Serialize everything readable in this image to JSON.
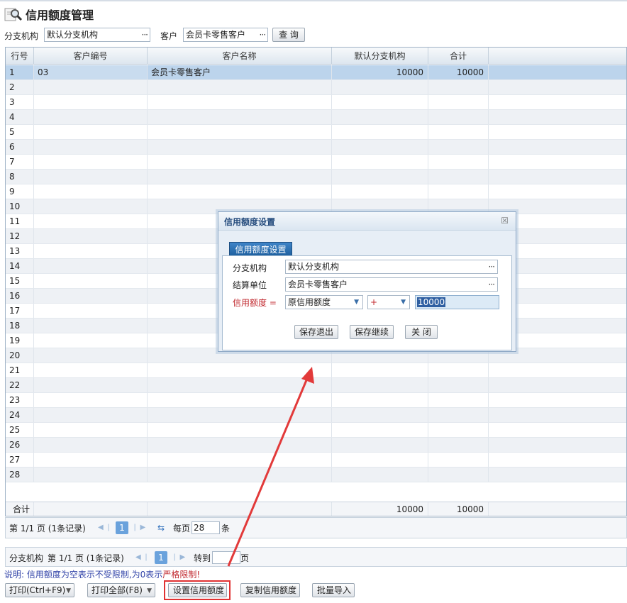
{
  "window": {
    "title": "信用额度管理"
  },
  "filter": {
    "branch_label": "分支机构",
    "branch_value": "默认分支机构",
    "customer_label": "客户",
    "customer_value": "会员卡零售客户",
    "query_button": "查 询"
  },
  "grid": {
    "columns": [
      "行号",
      "客户编号",
      "客户名称",
      "默认分支机构",
      "合计"
    ],
    "first_row": {
      "no": "1",
      "code": "03",
      "name": "会员卡零售客户",
      "branch_amount": "10000",
      "total": "10000"
    },
    "row_numbers": [
      "2",
      "3",
      "4",
      "5",
      "6",
      "7",
      "8",
      "9",
      "10",
      "11",
      "12",
      "13",
      "14",
      "15",
      "16",
      "17",
      "18",
      "19",
      "20",
      "21",
      "22",
      "23",
      "24",
      "25",
      "26",
      "27",
      "28"
    ],
    "footer": {
      "label": "合计",
      "branch_amount": "10000",
      "total": "10000"
    }
  },
  "pager": {
    "page_info": "第 1/1 页 (1条记录)",
    "current_page": "1",
    "per_page_label": "每页",
    "per_page_value": "28",
    "per_page_unit": "条"
  },
  "branch_pager": {
    "label": "分支机构",
    "page_info": "第 1/1 页 (1条记录)",
    "current_page": "1",
    "goto_label": "转到",
    "goto_unit": "页"
  },
  "note": {
    "prefix": "说明: 信用额度为空表示不受限制,为0表示",
    "emphasis": "严格限制!"
  },
  "buttons": {
    "print": "打印(Ctrl+F9)",
    "print_all": "打印全部(F8)",
    "set_credit": "设置信用额度",
    "copy_credit": "复制信用额度",
    "batch_import": "批量导入"
  },
  "dialog": {
    "title": "信用额度设置",
    "tab": "信用额度设置",
    "branch_label": "分支机构",
    "branch_value": "默认分支机构",
    "settle_label": "结算单位",
    "settle_value": "会员卡零售客户",
    "credit_label": "信用额度 =",
    "credit_base": "原信用额度",
    "operator": "+",
    "amount": "10000",
    "save_exit": "保存退出",
    "save_continue": "保存继续",
    "close": "关 闭"
  },
  "colors": {
    "accent": "#1e5f9e",
    "highlight": "#e03232",
    "selected_row": "#bcd4ec"
  }
}
